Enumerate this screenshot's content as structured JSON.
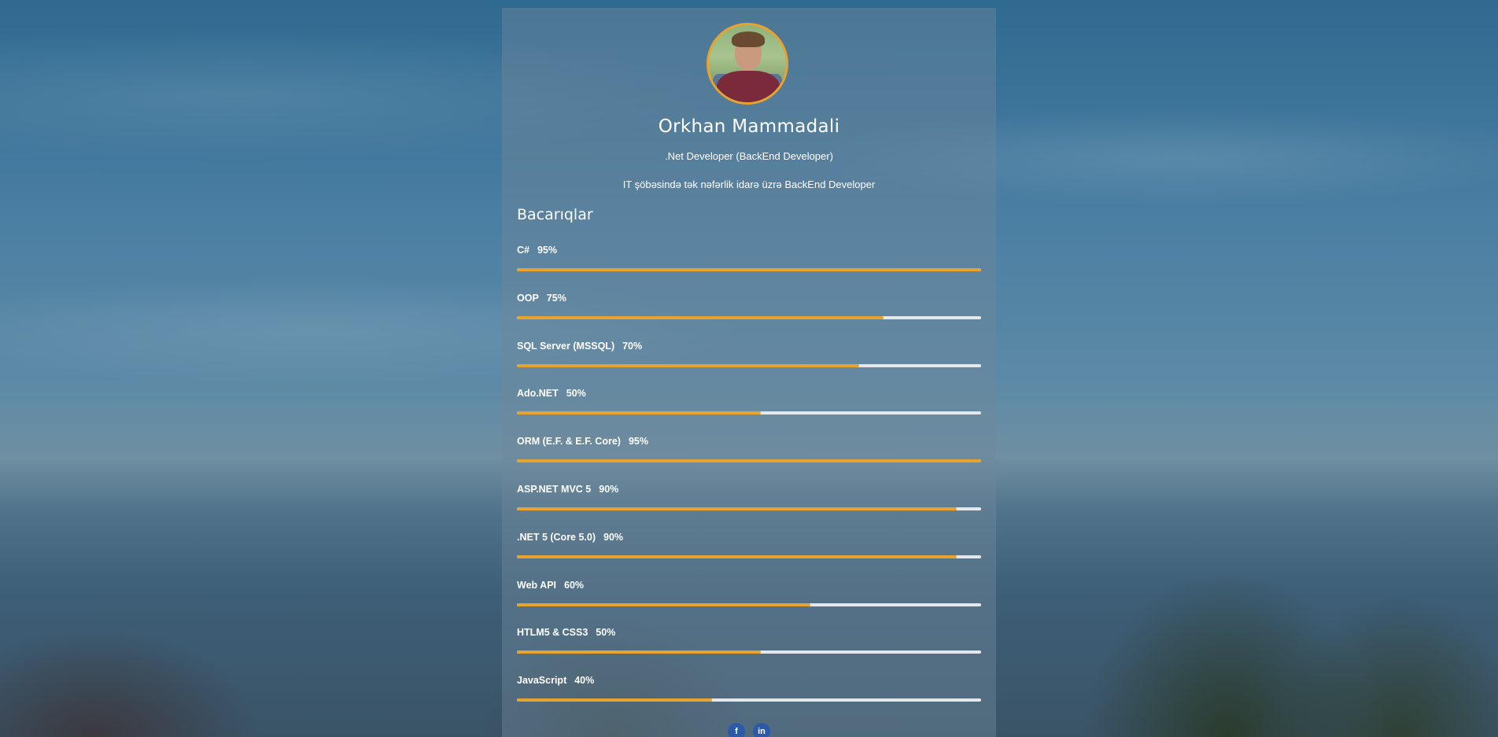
{
  "profile": {
    "name": "Orkhan Mammadali",
    "role": ".Net Developer (BackEnd Developer)",
    "description": "IT şöbəsində tək nəfərlik idarə üzrə BackEnd Developer",
    "avatar_border_color": "#e8a22e"
  },
  "skills_section": {
    "title": "Bacarıqlar",
    "bar_color": "#e8a22e",
    "track_color": "#e4e8ec",
    "items": [
      {
        "label": "C#",
        "percent_text": "95%",
        "fill": 1.0
      },
      {
        "label": "OOP",
        "percent_text": "75%",
        "fill": 0.79
      },
      {
        "label": "SQL Server (MSSQL)",
        "percent_text": "70%",
        "fill": 0.737
      },
      {
        "label": "Ado.NET",
        "percent_text": "50%",
        "fill": 0.526
      },
      {
        "label": "ORM (E.F. & E.F. Core)",
        "percent_text": "95%",
        "fill": 1.0
      },
      {
        "label": "ASP.NET MVC 5",
        "percent_text": "90%",
        "fill": 0.947
      },
      {
        "label": ".NET 5 (Core 5.0)",
        "percent_text": "90%",
        "fill": 0.947
      },
      {
        "label": "Web API",
        "percent_text": "60%",
        "fill": 0.632
      },
      {
        "label": "HTLM5 & CSS3",
        "percent_text": "50%",
        "fill": 0.526
      },
      {
        "label": "JavaScript",
        "percent_text": "40%",
        "fill": 0.421
      }
    ]
  },
  "social": [
    {
      "name": "facebook-icon",
      "glyph": "f"
    },
    {
      "name": "linkedin-icon",
      "glyph": "in"
    }
  ]
}
